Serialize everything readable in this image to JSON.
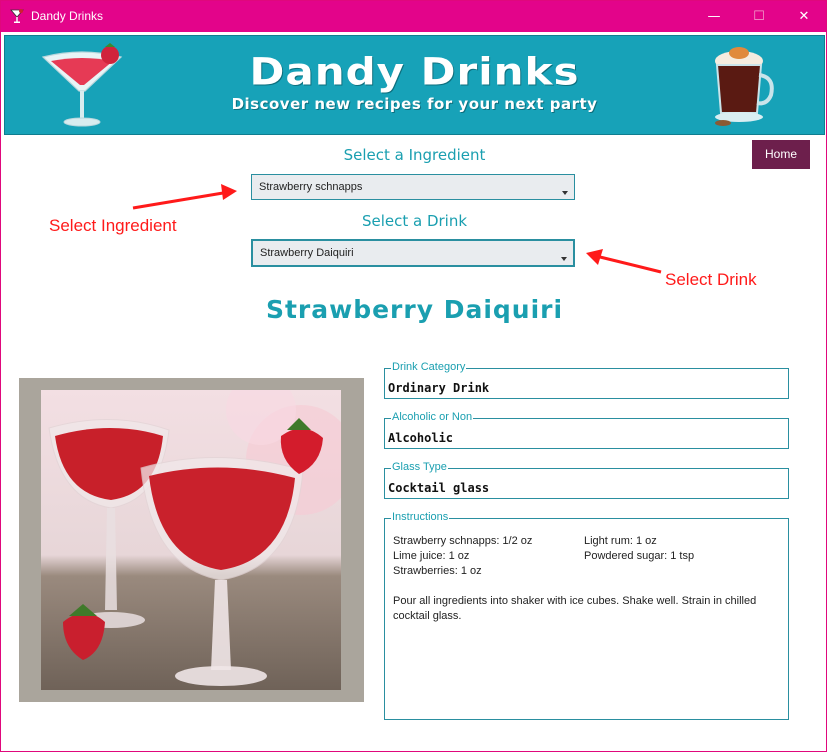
{
  "window": {
    "title": "Dandy Drinks",
    "controls": {
      "minimize": "—",
      "maximize": "☐",
      "close": "✕"
    }
  },
  "banner": {
    "title": "Dandy Drinks",
    "subtitle": "Discover new recipes for your next party"
  },
  "nav": {
    "home_label": "Home"
  },
  "ingredient_select": {
    "label": "Select a Ingredient",
    "value": "Strawberry schnapps"
  },
  "drink_select": {
    "label": "Select a Drink",
    "value": "Strawberry Daiquiri"
  },
  "annotations": {
    "ingredient": "Select Ingredient",
    "drink": "Select Drink",
    "color": "#ff1a1a"
  },
  "drink": {
    "name": "Strawberry Daiquiri",
    "category_label": "Drink Category",
    "category": "Ordinary Drink",
    "alcoholic_label": "Alcoholic or Non",
    "alcoholic": "Alcoholic",
    "glass_label": "Glass Type",
    "glass": "Cocktail glass",
    "instructions_label": "Instructions",
    "ingredients": [
      "Strawberry schnapps: 1/2 oz",
      "Light rum: 1 oz",
      "Lime juice: 1 oz",
      "Powdered sugar: 1 tsp",
      "Strawberries: 1 oz"
    ],
    "instructions": "Pour all ingredients into shaker with ice cubes. Shake well. Strain in chilled cocktail glass."
  },
  "colors": {
    "title_bar": "#e3048a",
    "banner": "#17a2b8",
    "accent_teal": "#1a9fb0",
    "home_button": "#6d1f4c"
  }
}
